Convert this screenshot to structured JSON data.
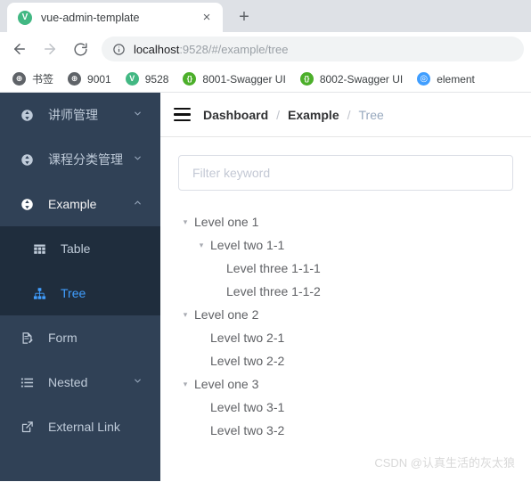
{
  "browser": {
    "tab": {
      "favicon_glyph": "V",
      "favicon_color": "#42b883",
      "title": "vue-admin-template",
      "close_label": "×"
    },
    "new_tab_label": "+",
    "nav": {
      "back_name": "back-button",
      "forward_name": "forward-button",
      "reload_name": "reload-button"
    },
    "omnibox": {
      "host": "localhost",
      "rest": ":9528/#/example/tree",
      "full_url": "localhost:9528/#/example/tree"
    },
    "bookmarks": [
      {
        "label": "书签",
        "icon": "globe-icon",
        "color": "#5f6368",
        "glyph": "⊕"
      },
      {
        "label": "9001",
        "icon": "globe-icon",
        "color": "#5f6368",
        "glyph": "⊕"
      },
      {
        "label": "9528",
        "icon": "vue-icon",
        "color": "#42b883",
        "glyph": "V"
      },
      {
        "label": "8001-Swagger UI",
        "icon": "swagger-icon",
        "color": "#4caf2a",
        "glyph": "{}"
      },
      {
        "label": "8002-Swagger UI",
        "icon": "swagger-icon",
        "color": "#4caf2a",
        "glyph": "{}"
      },
      {
        "label": "element",
        "icon": "element-icon",
        "color": "#409EFF",
        "glyph": "◎"
      }
    ]
  },
  "sidebar": {
    "bg_color": "#304156",
    "submenu_bg_color": "#1f2d3d",
    "active_color": "#409EFF",
    "items": [
      {
        "label": "讲师管理",
        "icon": "swap-circle-icon",
        "chevron": "⌄",
        "level": "top",
        "active": false
      },
      {
        "label": "课程分类管理",
        "icon": "swap-circle-icon",
        "chevron": "⌄",
        "level": "top",
        "active": false
      },
      {
        "label": "Example",
        "icon": "swap-circle-icon",
        "chevron": "⌃",
        "level": "top",
        "active": false
      },
      {
        "label": "Table",
        "icon": "table-grid-icon",
        "chevron": "",
        "level": "sub",
        "active": false
      },
      {
        "label": "Tree",
        "icon": "tree-hierarchy-icon",
        "chevron": "",
        "level": "sub",
        "active": true
      },
      {
        "label": "Form",
        "icon": "form-document-icon",
        "chevron": "",
        "level": "top",
        "active": false
      },
      {
        "label": "Nested",
        "icon": "nested-list-icon",
        "chevron": "⌄",
        "level": "top",
        "active": false
      },
      {
        "label": "External Link",
        "icon": "external-link-icon",
        "chevron": "",
        "level": "top",
        "active": false
      }
    ]
  },
  "navbar": {
    "hamburger_name": "hamburger-toggle",
    "breadcrumb": [
      {
        "label": "Dashboard",
        "current": false
      },
      {
        "label": "Example",
        "current": false
      },
      {
        "label": "Tree",
        "current": true
      }
    ],
    "separator": "/"
  },
  "content": {
    "filter": {
      "value": "",
      "placeholder": "Filter keyword"
    },
    "tree": [
      {
        "label": "Level one 1",
        "indent": 0,
        "arrow": "▾",
        "expandable": true
      },
      {
        "label": "Level two 1-1",
        "indent": 1,
        "arrow": "▾",
        "expandable": true
      },
      {
        "label": "Level three 1-1-1",
        "indent": 2,
        "arrow": "",
        "expandable": false
      },
      {
        "label": "Level three 1-1-2",
        "indent": 2,
        "arrow": "",
        "expandable": false
      },
      {
        "label": "Level one 2",
        "indent": 0,
        "arrow": "▾",
        "expandable": true
      },
      {
        "label": "Level two 2-1",
        "indent": 1,
        "arrow": "",
        "expandable": false
      },
      {
        "label": "Level two 2-2",
        "indent": 1,
        "arrow": "",
        "expandable": false
      },
      {
        "label": "Level one 3",
        "indent": 0,
        "arrow": "▾",
        "expandable": true
      },
      {
        "label": "Level two 3-1",
        "indent": 1,
        "arrow": "",
        "expandable": false
      },
      {
        "label": "Level two 3-2",
        "indent": 1,
        "arrow": "",
        "expandable": false
      }
    ]
  },
  "watermark": "CSDN @认真生活的灰太狼"
}
